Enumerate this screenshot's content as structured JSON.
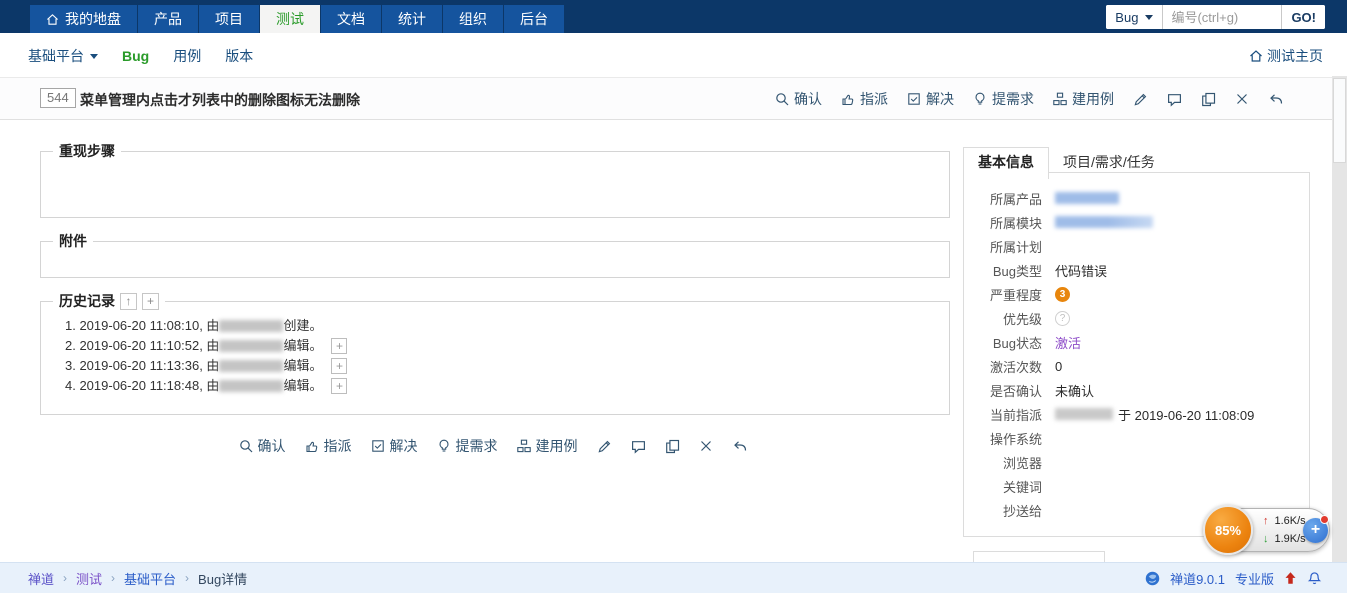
{
  "navbar": {
    "items": [
      {
        "label": "我的地盘"
      },
      {
        "label": "产品"
      },
      {
        "label": "项目"
      },
      {
        "label": "测试"
      },
      {
        "label": "文档"
      },
      {
        "label": "统计"
      },
      {
        "label": "组织"
      },
      {
        "label": "后台"
      }
    ],
    "search": {
      "module": "Bug",
      "placeholder": "编号(ctrl+g)",
      "go_label": "GO!"
    }
  },
  "subnav": {
    "product": "基础平台",
    "items": [
      {
        "label": "Bug"
      },
      {
        "label": "用例"
      },
      {
        "label": "版本"
      }
    ],
    "home_link": "测试主页"
  },
  "bug": {
    "id": "544",
    "title": "菜单管理内点击才列表中的删除图标无法删除"
  },
  "toolbar": {
    "confirm": "确认",
    "assign": "指派",
    "resolve": "解决",
    "to_story": "提需求",
    "to_case": "建用例"
  },
  "sections": {
    "steps": "重现步骤",
    "files": "附件",
    "history": "历史记录"
  },
  "icons": {
    "collapse": "↑",
    "add": "+",
    "expand": "+"
  },
  "history": [
    {
      "pre": "1. 2019-06-20 11:08:10, 由 ",
      "post": "创建。",
      "expandable": false
    },
    {
      "pre": "2. 2019-06-20 11:10:52, 由 ",
      "post": "编辑。",
      "expandable": true
    },
    {
      "pre": "3. 2019-06-20 11:13:36, 由 ",
      "post": "编辑。",
      "expandable": true
    },
    {
      "pre": "4. 2019-06-20 11:18:48, 由 ",
      "post": "编辑。",
      "expandable": true
    }
  ],
  "sidebar": {
    "tabs": [
      {
        "label": "基本信息"
      },
      {
        "label": "项目/需求/任务"
      }
    ],
    "fields": {
      "product": {
        "label": "所属产品",
        "value": ""
      },
      "module": {
        "label": "所属模块",
        "value": ""
      },
      "plan": {
        "label": "所属计划",
        "value": ""
      },
      "type": {
        "label": "Bug类型",
        "value": "代码错误"
      },
      "severity": {
        "label": "严重程度",
        "value": "3"
      },
      "priority": {
        "label": "优先级",
        "value": "?"
      },
      "status": {
        "label": "Bug状态",
        "value": "激活"
      },
      "activated": {
        "label": "激活次数",
        "value": "0"
      },
      "confirmed": {
        "label": "是否确认",
        "value": "未确认"
      },
      "assigned": {
        "label": "当前指派",
        "value": "于 2019-06-20 11:08:09"
      },
      "os": {
        "label": "操作系统",
        "value": ""
      },
      "browser": {
        "label": "浏览器",
        "value": ""
      },
      "keywords": {
        "label": "关键词",
        "value": ""
      },
      "mailto": {
        "label": "抄送给",
        "value": ""
      }
    }
  },
  "footer": {
    "breadcrumb": [
      {
        "label": "禅道"
      },
      {
        "label": "测试"
      },
      {
        "label": "基础平台"
      },
      {
        "label": "Bug详情"
      }
    ],
    "separator": "›",
    "version": "禅道9.0.1",
    "edition": "专业版"
  },
  "widget": {
    "percent": "85%",
    "up_speed": "1.6K/s",
    "down_speed": "1.9K/s",
    "plus": "+"
  },
  "colors": {
    "navbar": "#0c3768",
    "accent_green": "#2a9b2a",
    "severity_orange": "#e8860d",
    "status_active": "#8d4bc8"
  }
}
